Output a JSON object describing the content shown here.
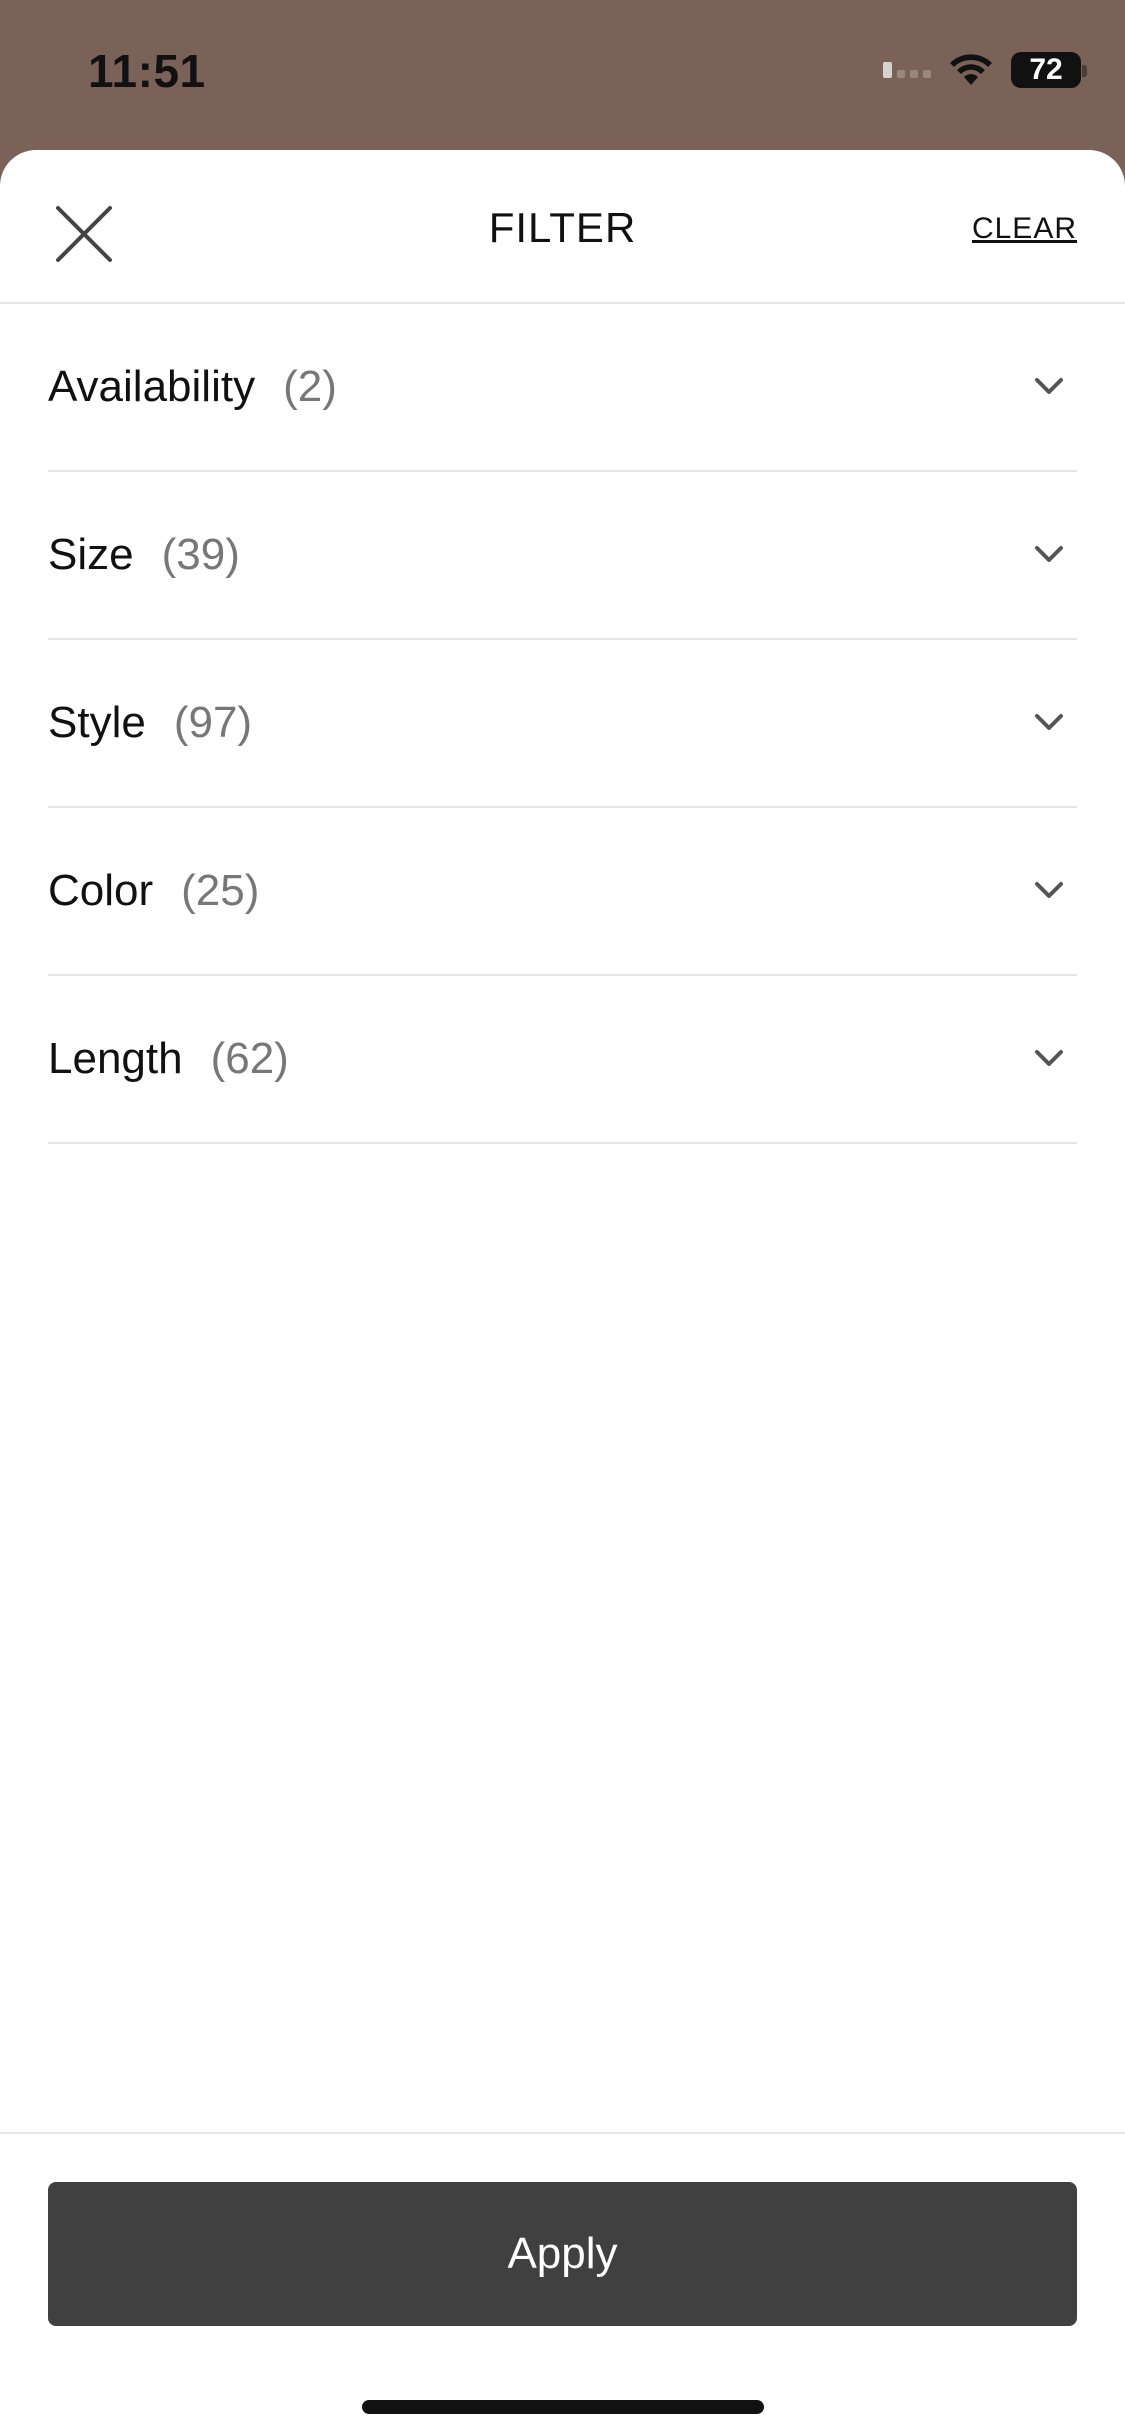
{
  "status_bar": {
    "time": "11:51",
    "battery": "72"
  },
  "header": {
    "title": "FILTER",
    "clear_label": "CLEAR",
    "close_icon": "close-icon"
  },
  "filters": [
    {
      "label": "Availability",
      "count": "(2)"
    },
    {
      "label": "Size",
      "count": "(39)"
    },
    {
      "label": "Style",
      "count": "(97)"
    },
    {
      "label": "Color",
      "count": "(25)"
    },
    {
      "label": "Length",
      "count": "(62)"
    }
  ],
  "footer": {
    "apply_label": "Apply"
  },
  "colors": {
    "backdrop": "#7a6259",
    "apply_button": "#404040",
    "divider": "#e4e4e4"
  }
}
